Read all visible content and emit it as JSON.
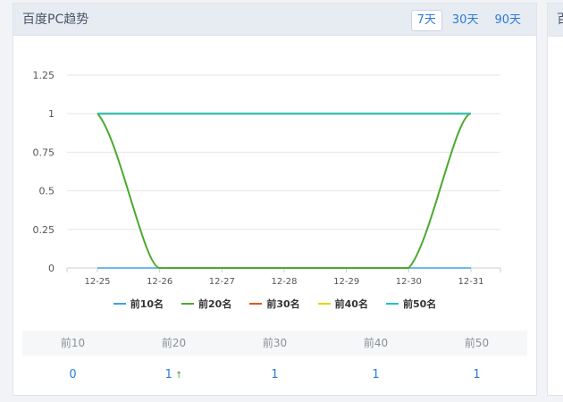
{
  "panel": {
    "title": "百度PC趋势",
    "tabs": [
      {
        "label": "7天",
        "active": true
      },
      {
        "label": "30天",
        "active": false
      },
      {
        "label": "90天",
        "active": false
      }
    ]
  },
  "right_panel": {
    "title_fragment": "百"
  },
  "chart_data": {
    "type": "line",
    "categories": [
      "12-25",
      "12-26",
      "12-27",
      "12-28",
      "12-29",
      "12-30",
      "12-31"
    ],
    "ylim": [
      0,
      1.25
    ],
    "yticks": [
      "0",
      "0.25",
      "0.5",
      "0.75",
      "1",
      "1.25"
    ],
    "grid": true,
    "legend": "bottom",
    "series": [
      {
        "name": "前10名",
        "color": "#3ea3e8",
        "values": [
          0,
          0,
          0,
          0,
          0,
          0,
          0
        ]
      },
      {
        "name": "前20名",
        "color": "#4aaa2e",
        "values": [
          1,
          0,
          0,
          0,
          0,
          0,
          1
        ]
      },
      {
        "name": "前30名",
        "color": "#e8541e",
        "values": [
          1,
          1,
          1,
          1,
          1,
          1,
          1
        ]
      },
      {
        "name": "前40名",
        "color": "#e6d200",
        "values": [
          1,
          1,
          1,
          1,
          1,
          1,
          1
        ]
      },
      {
        "name": "前50名",
        "color": "#1fc3c8",
        "values": [
          1,
          1,
          1,
          1,
          1,
          1,
          1
        ]
      }
    ]
  },
  "stats": {
    "headers": [
      "前10",
      "前20",
      "前30",
      "前40",
      "前50"
    ],
    "values": [
      "0",
      "1",
      "1",
      "1",
      "1"
    ],
    "trend_icon": "up-arrow-icon",
    "trend_glyph": "↑"
  }
}
